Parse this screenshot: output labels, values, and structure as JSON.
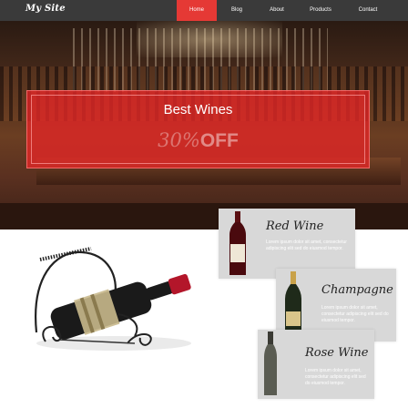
{
  "nav": {
    "logo": "My Site",
    "items": [
      {
        "label": "Home",
        "active": true
      },
      {
        "label": "Blog",
        "active": false
      },
      {
        "label": "About",
        "active": false
      },
      {
        "label": "Products",
        "active": false
      },
      {
        "label": "Contact",
        "active": false
      }
    ]
  },
  "promo": {
    "title": "Best Wines",
    "discount_number": "30%",
    "discount_word": "OFF"
  },
  "products": [
    {
      "name": "Red Wine",
      "description": "Lorem ipsum dolor sit amet, consectetur adipiscing elit sed do eiusmod tempor."
    },
    {
      "name": "Champagne",
      "description": "Lorem ipsum dolor sit amet, consectetur adipiscing elit sed do eiusmod tempor."
    },
    {
      "name": "Rose Wine",
      "description": "Lorem ipsum dolor sit amet, consectetur adipiscing elit sed do eiusmod tempor."
    }
  ],
  "colors": {
    "accent": "#e53935",
    "nav_bg": "#3a3a3a",
    "card_bg": "#d8d8d8"
  }
}
